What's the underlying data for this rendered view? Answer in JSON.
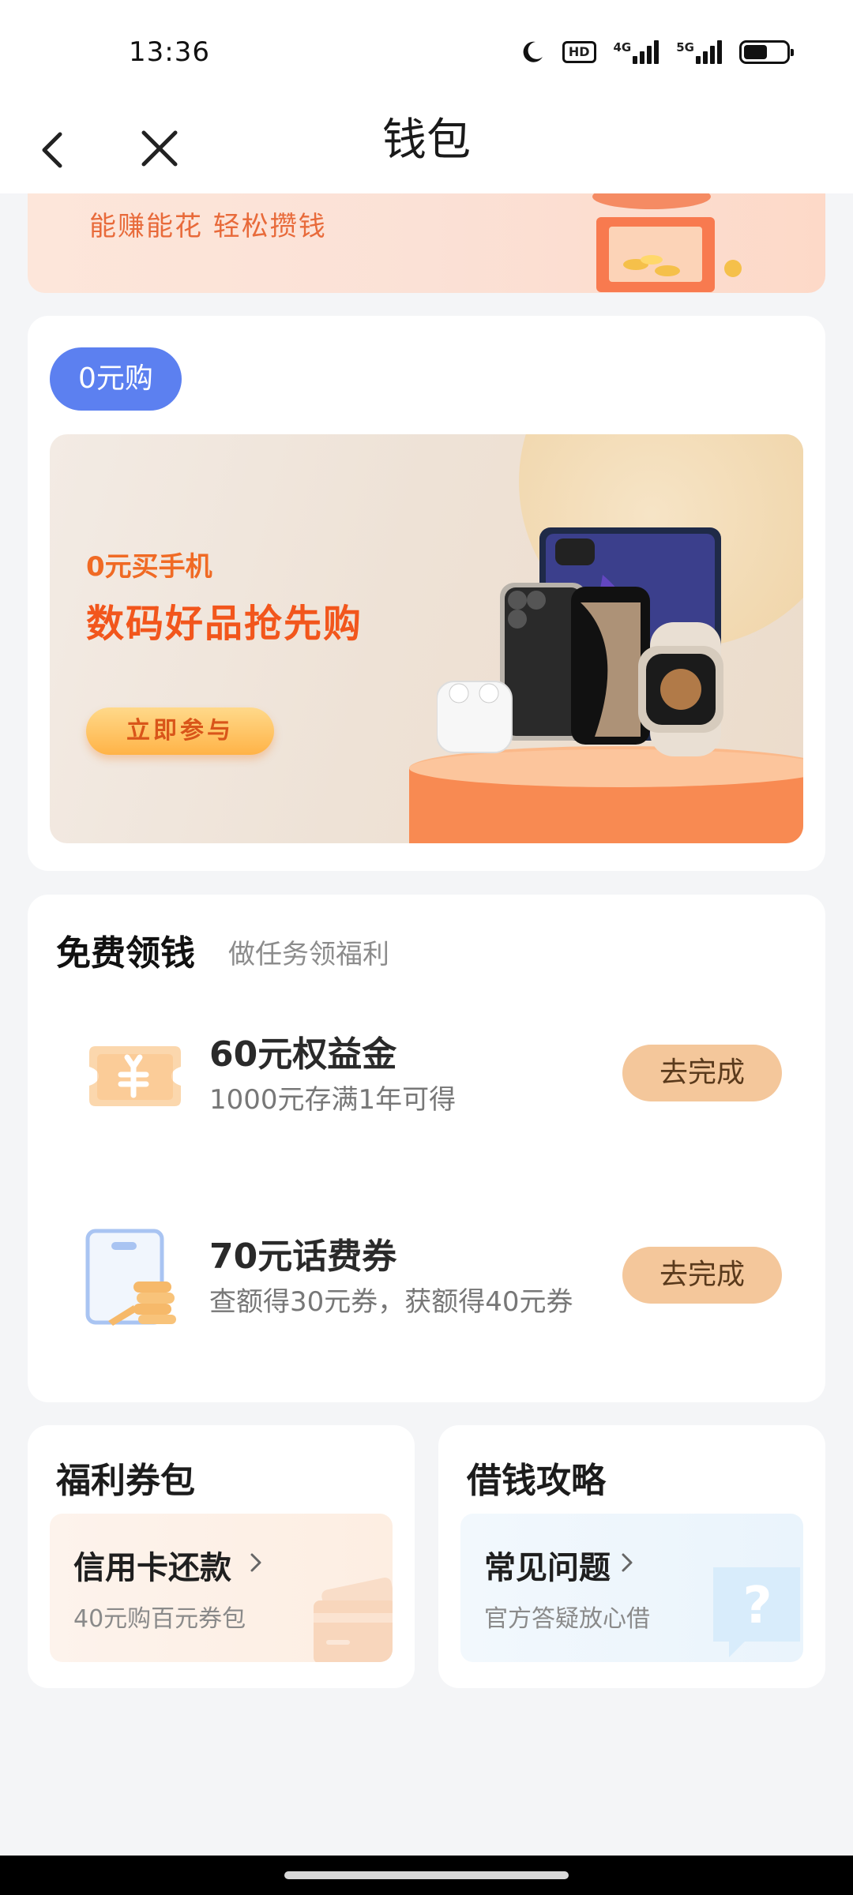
{
  "status_bar": {
    "time": "13:36",
    "hd_badge": "HD",
    "net1": "4G",
    "net2": "5G",
    "battery_level": 0.55
  },
  "nav": {
    "title": "钱包",
    "back_icon": "chevron-left-icon",
    "close_icon": "close-icon"
  },
  "top_banner": {
    "text": "能赚能花 轻松攒钱"
  },
  "zero_purchase": {
    "tag": "0元购",
    "promo": {
      "subtitle": "0元买手机",
      "title": "数码好品抢先购",
      "button": "立即参与"
    }
  },
  "free_money": {
    "title": "免费领钱",
    "subtitle": "做任务领福利",
    "tasks": [
      {
        "icon": "coupon-ticket-icon",
        "name": "60元权益金",
        "desc": "1000元存满1年可得",
        "button": "去完成"
      },
      {
        "icon": "phone-coins-icon",
        "name": "70元话费券",
        "desc": "查额得30元券，获额得40元券",
        "button": "去完成"
      }
    ]
  },
  "welfare": {
    "title": "福利券包",
    "item_label": "信用卡还款",
    "item_desc": "40元购百元券包"
  },
  "loan_guide": {
    "title": "借钱攻略",
    "item_label": "常见问题",
    "item_desc": "官方答疑放心借"
  },
  "colors": {
    "accent_blue": "#5c80f0",
    "task_button": "#f4c79b",
    "promo_orange": "#f2561c"
  }
}
